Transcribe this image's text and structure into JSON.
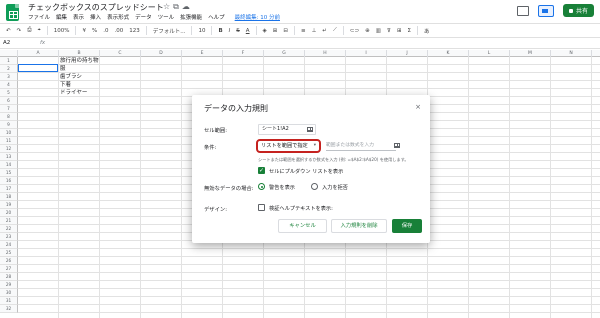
{
  "header": {
    "title": "チェックボックスのスプレッドシート",
    "title_icons": [
      "☆",
      "⧉",
      "☁"
    ],
    "menu": [
      "ファイル",
      "編集",
      "表示",
      "挿入",
      "表示形式",
      "データ",
      "ツール",
      "拡張機能",
      "ヘルプ"
    ],
    "last_edit": "最終編集: 10 分前",
    "share_label": "共有"
  },
  "toolbar": {
    "undo": "↶",
    "redo": "↷",
    "print": "⎙",
    "paint": "⌖",
    "zoom": "100%",
    "currency": "¥",
    "percent": "%",
    "dec_less": ".0",
    "dec_more": ".00",
    "more_formats": "123",
    "font": "デフォルト...",
    "font_size": "10",
    "bold": "B",
    "italic": "I",
    "strike": "S",
    "text_color": "A",
    "fill": "◈",
    "borders": "⊞",
    "merge": "⊟",
    "align": "≡",
    "valign": "⊥",
    "wrap": "↵",
    "rotate": "⟋",
    "link": "⊂⊃",
    "comment": "⊕",
    "chart": "▥",
    "filter": "⊽",
    "view": "⊞",
    "sum": "Σ",
    "input_tools": "あ"
  },
  "formula_bar": {
    "cell_ref": "A2",
    "fx": "fx"
  },
  "sheet": {
    "columns": [
      "A",
      "B",
      "C",
      "D",
      "E",
      "F",
      "G",
      "H",
      "I",
      "J",
      "K",
      "L",
      "M",
      "N"
    ],
    "rows": [
      "1",
      "2",
      "3",
      "4",
      "5",
      "6",
      "7",
      "8",
      "9",
      "10",
      "11",
      "12",
      "13",
      "14",
      "15",
      "16",
      "17",
      "18",
      "19",
      "20",
      "21",
      "22",
      "23",
      "24",
      "25",
      "26",
      "27",
      "28",
      "29",
      "30",
      "31",
      "32"
    ],
    "cells": {
      "b1": "旅行用の持ち物",
      "b2": "服",
      "b3": "歯ブラシ",
      "b4": "下着",
      "b5": "ドライヤー"
    }
  },
  "dialog": {
    "title": "データの入力規則",
    "close": "×",
    "range_label": "セル範囲:",
    "range_value": "シート1!A2",
    "criteria_label": "条件:",
    "criteria_value": "リストを範囲で指定",
    "criteria_placeholder": "範囲または数式を入力",
    "hint": "シートまたは範囲を選択するか数式を入力 (例: =$A$2:$A$20) を使用します。",
    "dropdown_option": "セルにプルダウン リストを表示",
    "invalid_label": "無効なデータの場合:",
    "invalid_warn": "警告を表示",
    "invalid_reject": "入力を拒否",
    "appearance_label": "デザイン:",
    "help_text_option": "検証ヘルプテキストを表示:",
    "cancel": "キャンセル",
    "remove": "入力規則を削除",
    "save": "保存"
  },
  "colors": {
    "accent": "#188038",
    "highlight": "#c5221f",
    "selection": "#1a73e8"
  }
}
